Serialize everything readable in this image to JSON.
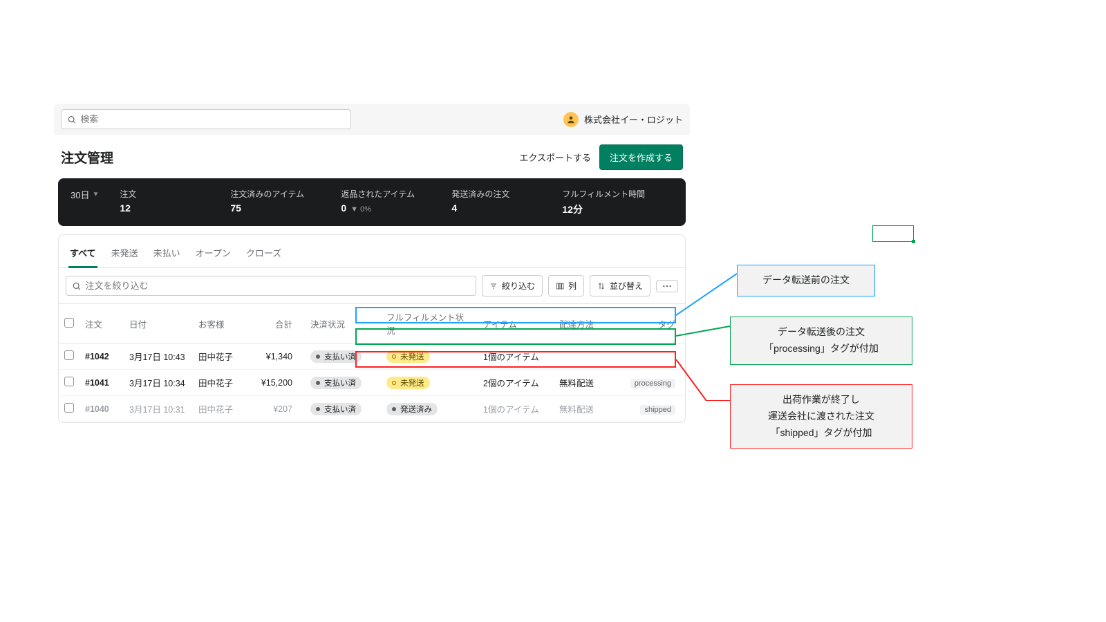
{
  "topbar": {
    "search_placeholder": "検索",
    "user_name": "株式会社イー・ロジット"
  },
  "page": {
    "title": "注文管理"
  },
  "actions": {
    "export": "エクスポートする",
    "create": "注文を作成する"
  },
  "stats": {
    "period": "30日",
    "orders_label": "注文",
    "orders_value": "12",
    "items_label": "注文済みのアイテム",
    "items_value": "75",
    "returned_label": "返品されたアイテム",
    "returned_value": "0",
    "returned_delta": "▼ 0%",
    "shipped_label": "発送済みの注文",
    "shipped_value": "4",
    "fulfill_time_label": "フルフィルメント時間",
    "fulfill_time_value": "12分"
  },
  "tabs": [
    "すべて",
    "未発送",
    "未払い",
    "オープン",
    "クローズ"
  ],
  "filter": {
    "placeholder": "注文を絞り込む",
    "narrow": "絞り込む",
    "columns": "列",
    "sort": "並び替え"
  },
  "columns": {
    "order": "注文",
    "date": "日付",
    "customer": "お客様",
    "total": "合計",
    "payment": "決済状況",
    "fulfillment": "フルフィルメント状況",
    "items": "アイテム",
    "delivery": "配達方法",
    "tags": "タグ"
  },
  "rows": [
    {
      "id": "#1042",
      "date": "3月17日 10:43",
      "customer": "田中花子",
      "total": "¥1,340",
      "payment": "支払い済",
      "fulfillment_kind": "unful",
      "fulfillment": "未発送",
      "items": "1個のアイテム",
      "delivery": "",
      "tag": ""
    },
    {
      "id": "#1041",
      "date": "3月17日 10:34",
      "customer": "田中花子",
      "total": "¥15,200",
      "payment": "支払い済",
      "fulfillment_kind": "unful",
      "fulfillment": "未発送",
      "items": "2個のアイテム",
      "delivery": "無料配送",
      "tag": "processing"
    },
    {
      "id": "#1040",
      "date": "3月17日 10:31",
      "customer": "田中花子",
      "total": "¥207",
      "payment": "支払い済",
      "fulfillment_kind": "ful",
      "fulfillment": "発送済み",
      "items": "1個のアイテム",
      "delivery": "無料配送",
      "tag": "shipped"
    }
  ],
  "annotations": {
    "blue": "データ転送前の注文",
    "green": "データ転送後の注文\n「processing」タグが付加",
    "red": "出荷作業が終了し\n運送会社に渡された注文\n「shipped」タグが付加"
  }
}
